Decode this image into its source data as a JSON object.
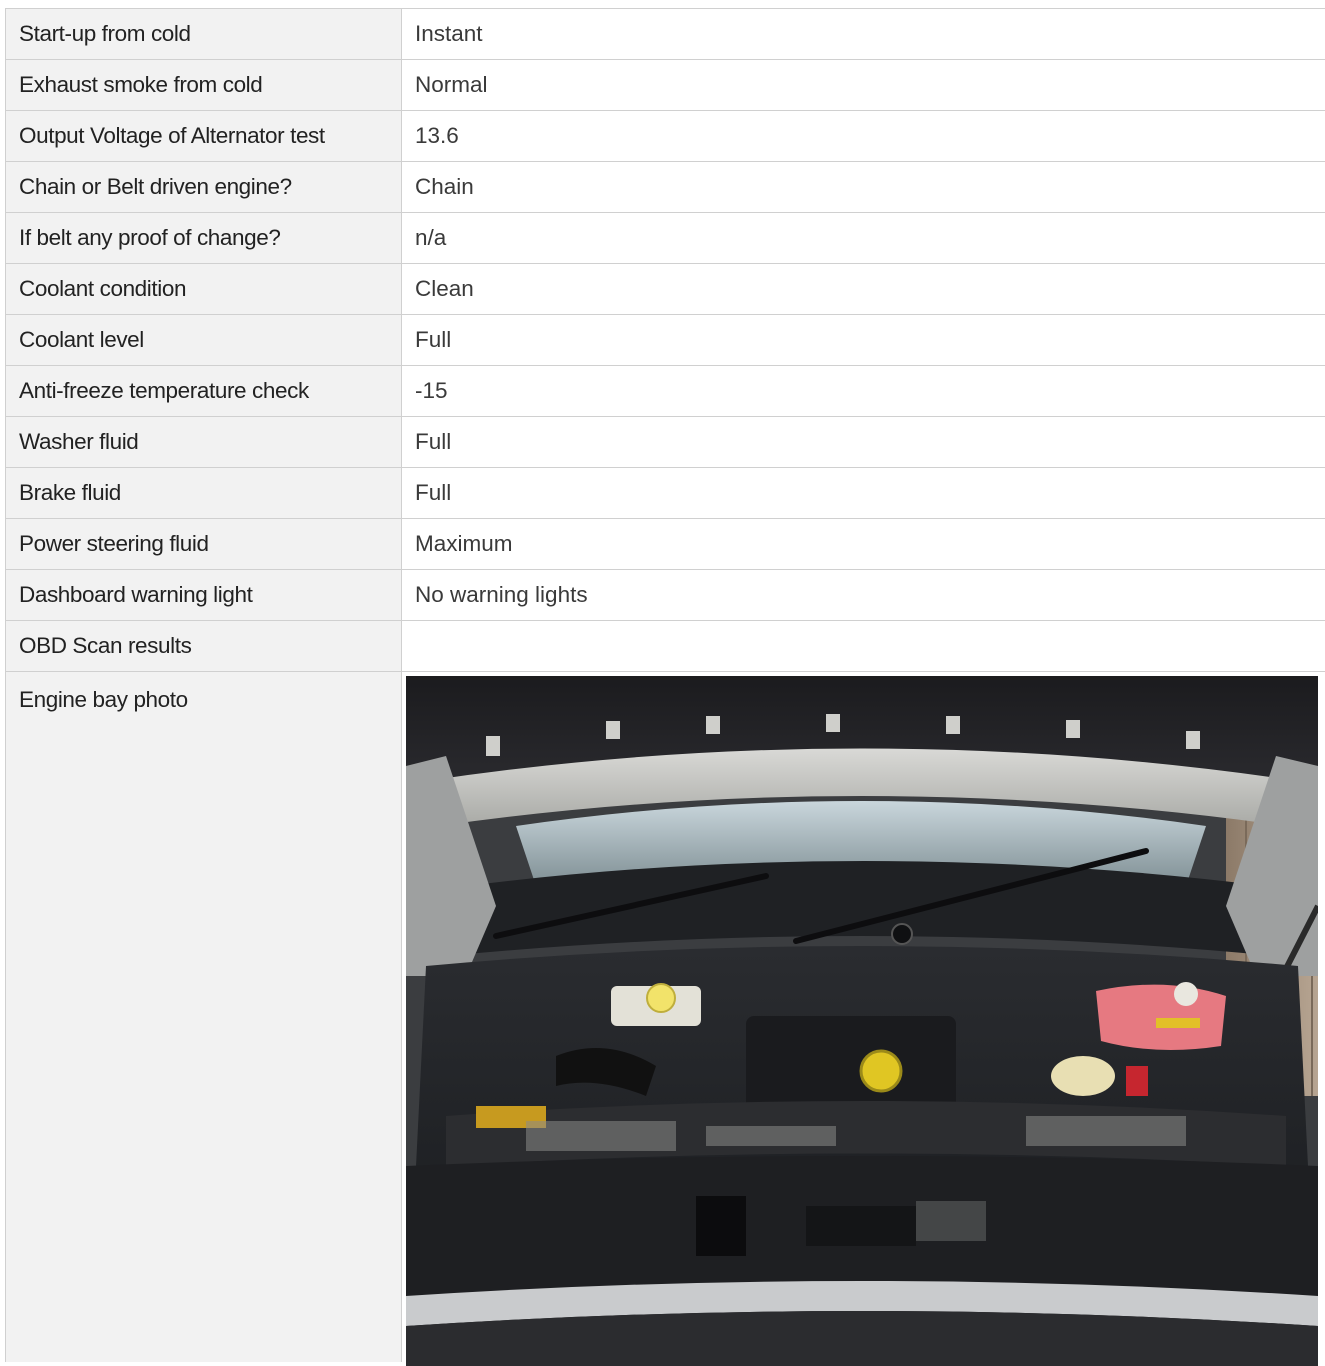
{
  "rows": [
    {
      "label": "Start-up from cold",
      "value": "Instant"
    },
    {
      "label": "Exhaust smoke from cold",
      "value": "Normal"
    },
    {
      "label": "Output Voltage of Alternator test",
      "value": "13.6"
    },
    {
      "label": "Chain or Belt driven engine?",
      "value": "Chain"
    },
    {
      "label": "If belt any proof of change?",
      "value": "n/a"
    },
    {
      "label": "Coolant condition",
      "value": "Clean"
    },
    {
      "label": "Coolant level",
      "value": "Full"
    },
    {
      "label": "Anti-freeze temperature check",
      "value": "-15"
    },
    {
      "label": "Washer fluid",
      "value": "Full"
    },
    {
      "label": "Brake fluid",
      "value": "Full"
    },
    {
      "label": "Power steering fluid",
      "value": "Maximum"
    },
    {
      "label": "Dashboard warning light",
      "value": "No warning lights"
    },
    {
      "label": "OBD Scan results",
      "value": ""
    }
  ],
  "photo_row": {
    "label": "Engine bay photo"
  }
}
